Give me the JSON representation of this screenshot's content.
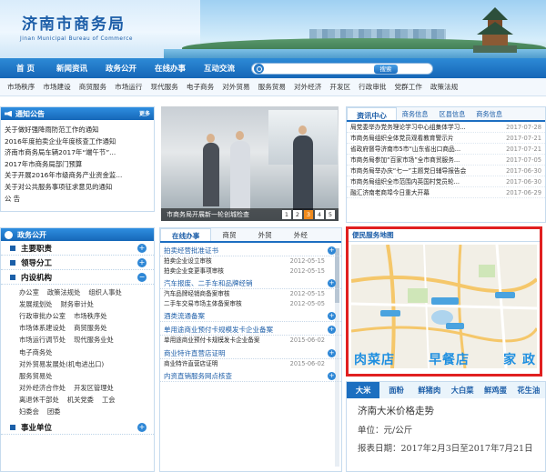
{
  "header": {
    "title_cn": "济南市商务局",
    "title_en": "Jinan Municipal Bureau of Commerce"
  },
  "nav": {
    "items": [
      "首 页",
      "新闻资讯",
      "政务公开",
      "在线办事",
      "互动交流"
    ]
  },
  "search": {
    "placeholder": "",
    "button": "搜索"
  },
  "subnav": {
    "items": [
      "市场秩序",
      "市场建设",
      "商贸服务",
      "市场运行",
      "现代服务",
      "电子商务",
      "对外贸易",
      "服务贸易",
      "对外经济",
      "开发区",
      "行政审批",
      "党群工作",
      "政策法规"
    ]
  },
  "notice": {
    "title": "通知公告",
    "more": "更多",
    "items": [
      "关于做好强降雨防范工作的通知",
      "2016年度拍卖企业年度核查工作通知",
      "济南市商务局车辆2017年“端午节”...",
      "2017年市商务局部门预算",
      "关于开展2016年市级商务产业资金监...",
      "关于对公共服务事项征求意见的通知",
      "公 告"
    ]
  },
  "gov": {
    "title": "政务公开",
    "cats": [
      {
        "name": "主要职责"
      },
      {
        "name": "领导分工"
      },
      {
        "name": "内设机构"
      }
    ],
    "units": [
      [
        "办公室",
        "政策法规处",
        "组织人事处"
      ],
      [
        "发展规划处",
        "财务审计处"
      ],
      [
        "行政审批办公室",
        "市场秩序处"
      ],
      [
        "市场体系建设处",
        "商贸服务处"
      ],
      [
        "市场运行调节处",
        "现代服务业处"
      ],
      [
        "电子商务处"
      ],
      [
        "对外贸易发展处(机电进出口)"
      ],
      [
        "服务贸易处"
      ],
      [
        "对外经济合作处",
        "开发区管理处"
      ],
      [
        "离退休干部处",
        "机关党委",
        "工会"
      ],
      [
        "妇委会",
        "团委"
      ]
    ],
    "last_cat": "事业单位"
  },
  "banner": {
    "caption": "市商务局开展新一轮创城检查",
    "pages": [
      "1",
      "2",
      "3",
      "4",
      "5"
    ],
    "active": "3"
  },
  "online": {
    "tabs": [
      "在线办事",
      "商贸",
      "外贸",
      "外经"
    ],
    "sections": [
      {
        "title": "拍卖经营批准证书",
        "items": [
          {
            "t": "拍卖企业设立审核",
            "d": "2012-05-15"
          },
          {
            "t": "拍卖企业变更事项审核",
            "d": "2012-05-15"
          }
        ]
      },
      {
        "title": "汽车报废、二手车和品牌经销",
        "items": [
          {
            "t": "汽车品牌经销商备案审核",
            "d": "2012-05-15"
          },
          {
            "t": "二手车交易市场主体备案审核",
            "d": "2012-05-05"
          }
        ]
      },
      {
        "title": "酒类流通备案",
        "items": []
      },
      {
        "title": "单用途商业预付卡规模发卡企业备案",
        "items": [
          {
            "t": "单用途商业预付卡规模发卡企业备案",
            "d": "2015-06-02"
          }
        ]
      },
      {
        "title": "商业特许直营店证明",
        "items": [
          {
            "t": "商业特许直营店证明",
            "d": "2015-06-02"
          }
        ]
      },
      {
        "title": "内资直销服务网点核查",
        "items": []
      }
    ]
  },
  "news": {
    "tabs": [
      "资讯中心",
      "商务信息",
      "区县信息",
      "商务信息"
    ],
    "items": [
      {
        "t": "局党委举办党务理论学习中心组集体学习...",
        "d": "2017-07-28"
      },
      {
        "t": "市商务局组织全体党员观看教育警示片",
        "d": "2017-07-21"
      },
      {
        "t": "省政府督导济南市5市“山东省出口商品...",
        "d": "2017-07-21"
      },
      {
        "t": "市商务局参加“百家市场”全市商贸服务...",
        "d": "2017-07-05"
      },
      {
        "t": "市商务局举办庆“七一”主题党日辅导报告会",
        "d": "2017-06-30"
      },
      {
        "t": "市商务局组织全市范围内英国村党员轮...",
        "d": "2017-06-30"
      },
      {
        "t": "融汇济南老商埠今日重大开幕",
        "d": "2017-06-29"
      }
    ]
  },
  "map": {
    "title": "便民服务地图",
    "categories": [
      "肉菜店",
      "早餐店",
      "家 政"
    ]
  },
  "price": {
    "tabs": [
      "大米",
      "面粉",
      "鲜猪肉",
      "大白菜",
      "鲜鸡蛋",
      "花生油"
    ],
    "active": "大米",
    "title": "济南大米价格走势",
    "unit": "单位：元/公斤",
    "period": "报表日期：2017年2月3日至2017年7月21日"
  }
}
